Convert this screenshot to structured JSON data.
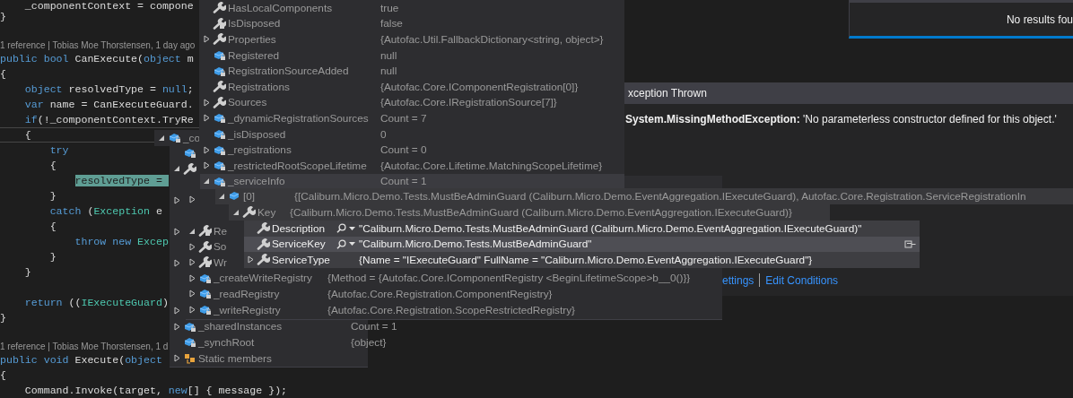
{
  "editor": {
    "lines": [
      {
        "kind": "code",
        "current": false,
        "segments": [
          {
            "text": "    _componentContext = compone",
            "kind": "plain"
          }
        ]
      },
      {
        "kind": "code",
        "current": false,
        "segments": [
          {
            "text": "}",
            "kind": "plain"
          }
        ]
      },
      {
        "kind": "blank"
      },
      {
        "kind": "codelens",
        "text": "1 reference | Tobias Moe Thorstensen, 1 day ago"
      },
      {
        "kind": "code",
        "current": false,
        "segments": [
          {
            "text": "public bool",
            "kind": "kw"
          },
          {
            "text": " CanExecute(",
            "kind": "plain"
          },
          {
            "text": "object",
            "kind": "kw"
          },
          {
            "text": " m",
            "kind": "plain"
          }
        ]
      },
      {
        "kind": "code",
        "current": false,
        "segments": [
          {
            "text": "{",
            "kind": "plain"
          }
        ]
      },
      {
        "kind": "code",
        "current": false,
        "segments": [
          {
            "text": "    object",
            "kind": "kw"
          },
          {
            "text": " resolvedType = ",
            "kind": "plain"
          },
          {
            "text": "null",
            "kind": "kw"
          },
          {
            "text": ";",
            "kind": "plain"
          }
        ]
      },
      {
        "kind": "code",
        "current": false,
        "segments": [
          {
            "text": "    var",
            "kind": "kw"
          },
          {
            "text": " name = CanExecuteGuard.",
            "kind": "plain"
          }
        ]
      },
      {
        "kind": "code",
        "current": false,
        "segments": [
          {
            "text": "    if",
            "kind": "kw"
          },
          {
            "text": "(!_componentContext.TryRe",
            "kind": "plain"
          }
        ]
      },
      {
        "kind": "code",
        "current": true,
        "segments": [
          {
            "text": "    {",
            "kind": "plain"
          }
        ]
      },
      {
        "kind": "code",
        "current": false,
        "segments": [
          {
            "text": "        try",
            "kind": "kw"
          }
        ]
      },
      {
        "kind": "code",
        "current": false,
        "segments": [
          {
            "text": "        {",
            "kind": "plain"
          }
        ]
      },
      {
        "kind": "code",
        "current": false,
        "segments": [
          {
            "text": "            resolvedType = ",
            "kind": "hl"
          }
        ]
      },
      {
        "kind": "code",
        "current": false,
        "segments": [
          {
            "text": "        }",
            "kind": "plain"
          }
        ]
      },
      {
        "kind": "code",
        "current": false,
        "segments": [
          {
            "text": "        catch",
            "kind": "kw"
          },
          {
            "text": " (",
            "kind": "plain"
          },
          {
            "text": "Exception",
            "kind": "type"
          },
          {
            "text": " e",
            "kind": "plain"
          }
        ]
      },
      {
        "kind": "code",
        "current": false,
        "segments": [
          {
            "text": "        {",
            "kind": "plain"
          }
        ]
      },
      {
        "kind": "code",
        "current": false,
        "segments": [
          {
            "text": "            throw new",
            "kind": "kw"
          },
          {
            "text": " Excep",
            "kind": "type"
          }
        ]
      },
      {
        "kind": "code",
        "current": false,
        "segments": [
          {
            "text": "        }",
            "kind": "plain"
          }
        ]
      },
      {
        "kind": "code",
        "current": false,
        "segments": [
          {
            "text": "    }",
            "kind": "plain"
          }
        ]
      },
      {
        "kind": "blank"
      },
      {
        "kind": "code",
        "current": false,
        "segments": [
          {
            "text": "    return",
            "kind": "kw"
          },
          {
            "text": " ((",
            "kind": "plain"
          },
          {
            "text": "IExecuteGuard",
            "kind": "type"
          },
          {
            "text": ")",
            "kind": "plain"
          }
        ]
      },
      {
        "kind": "code",
        "current": false,
        "segments": [
          {
            "text": "}",
            "kind": "plain"
          }
        ]
      },
      {
        "kind": "blank"
      },
      {
        "kind": "codelens",
        "text": "1 reference | Tobias Moe Thorstensen, 1 d"
      },
      {
        "kind": "code",
        "current": false,
        "segments": [
          {
            "text": "public void",
            "kind": "kw"
          },
          {
            "text": " Execute(",
            "kind": "plain"
          },
          {
            "text": "object",
            "kind": "kw"
          }
        ]
      },
      {
        "kind": "code",
        "current": false,
        "segments": [
          {
            "text": "{",
            "kind": "plain"
          }
        ]
      },
      {
        "kind": "code",
        "current": false,
        "segments": [
          {
            "text": "    Command.Invoke(target, ",
            "kind": "plain"
          },
          {
            "text": "new",
            "kind": "kw"
          },
          {
            "text": "[] { message });",
            "kind": "plain"
          }
        ]
      }
    ]
  },
  "search_results": {
    "message": "No results fou"
  },
  "panels": [
    {
      "active": false,
      "rows": [
        {
          "kind": "property",
          "name": "HasLocalComponents",
          "value": "true",
          "selected": false
        },
        {
          "kind": "locked-property",
          "name": "IsDisposed",
          "value": "false",
          "selected": false
        },
        {
          "kind": "property",
          "expanded": false,
          "name": "Properties",
          "value": "{Autofac.Util.FallbackDictionary<string, object>}",
          "selected": false
        },
        {
          "kind": "locked-field",
          "name": "Registered",
          "value": "null",
          "selected": false
        },
        {
          "kind": "locked-field",
          "name": "RegistrationSourceAdded",
          "value": "null",
          "selected": false
        },
        {
          "kind": "property",
          "name": "Registrations",
          "value": "{Autofac.Core.IComponentRegistration[0]}",
          "selected": false
        },
        {
          "kind": "property",
          "expanded": false,
          "name": "Sources",
          "value": "{Autofac.Core.IRegistrationSource[7]}",
          "selected": false
        },
        {
          "kind": "locked-field",
          "expanded": false,
          "name": "_dynamicRegistrationSources",
          "value": "Count = 7",
          "selected": false
        },
        {
          "kind": "locked-field",
          "name": "_isDisposed",
          "value": "0",
          "selected": false
        },
        {
          "kind": "locked-field",
          "expanded": false,
          "name": "_registrations",
          "value": "Count = 0",
          "selected": false
        },
        {
          "kind": "locked-field",
          "expanded": false,
          "name": "_restrictedRootScopeLifetime",
          "value": "{Autofac.Core.Lifetime.MatchingScopeLifetime}",
          "selected": false
        },
        {
          "kind": "locked-field",
          "expanded": true,
          "name": "_serviceInfo",
          "value": "Count = 1",
          "selected": true
        }
      ]
    },
    {
      "active": false,
      "rows": [
        {
          "kind": "locked-field",
          "expanded": true,
          "name": "_co"
        }
      ]
    },
    {
      "active": false,
      "rows": [
        {
          "kind": "covered",
          "expanded": false
        },
        {
          "kind": "locked-property",
          "expanded": true,
          "name": "Re"
        },
        {
          "kind": "property",
          "expanded": false,
          "name": "So"
        },
        {
          "kind": "locked-property",
          "expanded": false,
          "name": "Wr"
        },
        {
          "kind": "locked-field",
          "expanded": false,
          "name": "_createWriteRegistry",
          "value": "{Method = {Autofac.Core.IComponentRegistry <BeginLifetimeScope>b__0()}}"
        },
        {
          "kind": "locked-field",
          "expanded": false,
          "name": "_readRegistry",
          "value": "{Autofac.Core.Registration.ComponentRegistry}"
        },
        {
          "kind": "locked-field",
          "expanded": false,
          "name": "_writeRegistry",
          "value": "{Autofac.Core.Registration.ScopeRestrictedRegistry}"
        }
      ]
    },
    {
      "active": false,
      "rows": [
        {
          "kind": "locked-field"
        },
        {
          "kind": "property",
          "expanded": true
        },
        {
          "kind": "covered",
          "expanded": false
        },
        {
          "kind": "covered",
          "expanded": false
        },
        {
          "kind": "covered",
          "expanded": false
        },
        {
          "kind": "covered",
          "expanded": false
        },
        {
          "kind": "locked-field",
          "expanded": false,
          "name": "_sharedInstances",
          "value": "Count = 1"
        },
        {
          "kind": "locked-field",
          "name": "_synchRoot",
          "value": "{object}"
        },
        {
          "kind": "static",
          "expanded": false,
          "name": "Static members"
        }
      ]
    },
    {
      "active": false,
      "rows": [
        {
          "kind": "field",
          "expanded": true,
          "name": "[0]",
          "value": "{[Caliburn.Micro.Demo.Tests.MustBeAdminGuard (Caliburn.Micro.Demo.EventAggregation.IExecuteGuard), Autofac.Core.Registration.ServiceRegistrationIn"
        }
      ]
    },
    {
      "active": false,
      "rows": [
        {
          "kind": "property",
          "expanded": true,
          "name": "Key",
          "value": "{Caliburn.Micro.Demo.Tests.MustBeAdminGuard (Caliburn.Micro.Demo.EventAggregation.IExecuteGuard)}"
        }
      ]
    },
    {
      "active": true,
      "rows": [
        {
          "kind": "property",
          "name": "Description",
          "visualizer": true,
          "value": "\"Caliburn.Micro.Demo.Tests.MustBeAdminGuard (Caliburn.Micro.Demo.EventAggregation.IExecuteGuard)\"",
          "selected": false
        },
        {
          "kind": "property",
          "name": "ServiceKey",
          "visualizer": true,
          "value": "\"Caliburn.Micro.Demo.Tests.MustBeAdminGuard\"",
          "selected": true
        },
        {
          "kind": "property",
          "expanded": false,
          "name": "ServiceType",
          "visualizer": false,
          "value": "{Name = \"IExecuteGuard\" FullName = \"Caliburn.Micro.Demo.EventAggregation.IExecuteGuard\"}",
          "selected": false
        }
      ]
    }
  ],
  "exception": {
    "title": "xception Thrown",
    "message": "**System.MissingMethodException:** 'No parameterless constructor defined for this object.'",
    "links": [
      "ettings",
      "Edit Conditions"
    ]
  }
}
